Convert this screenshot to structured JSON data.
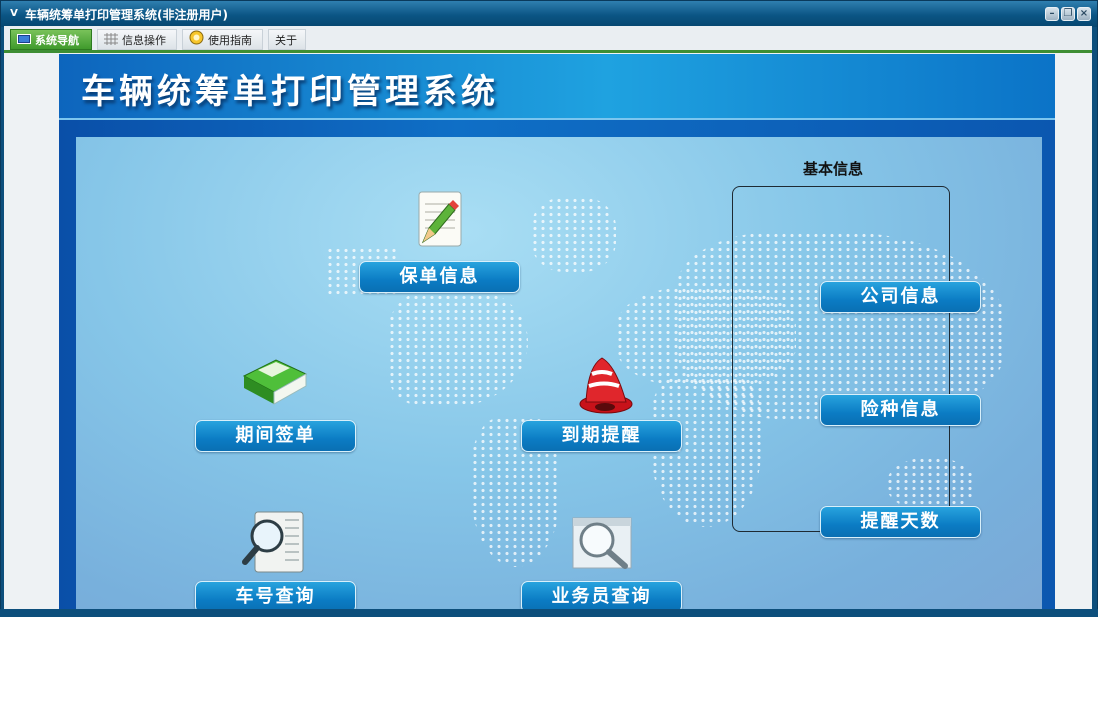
{
  "window": {
    "title": "车辆统筹单打印管理系统(非注册用户)",
    "logo_text": "V",
    "controls": [
      "minimize-icon",
      "restore-icon",
      "close-icon"
    ]
  },
  "menu": {
    "tabs": [
      {
        "label": "系统导航",
        "icon": "monitor-icon",
        "active": true
      },
      {
        "label": "信息操作",
        "icon": "grid-icon",
        "active": false
      },
      {
        "label": "使用指南",
        "icon": "help-icon",
        "active": false
      },
      {
        "label": "关于",
        "icon": "",
        "active": false
      }
    ]
  },
  "header": {
    "title": "车辆统筹单打印管理系统"
  },
  "nav": {
    "policy_info": "保单信息",
    "period_sign": "期间签单",
    "expiry_reminder": "到期提醒",
    "plate_query": "车号查询",
    "agent_query": "业务员查询"
  },
  "basic_info": {
    "title": "基本信息",
    "company_info": "公司信息",
    "insurance_types": "险种信息",
    "reminder_days": "提醒天数"
  },
  "colors": {
    "titlebar": "#0b5584",
    "active_tab": "#3f9a2c",
    "header": "#1fa2e0",
    "button": "#0b7cc4",
    "map_bg": "#86c6e8"
  }
}
